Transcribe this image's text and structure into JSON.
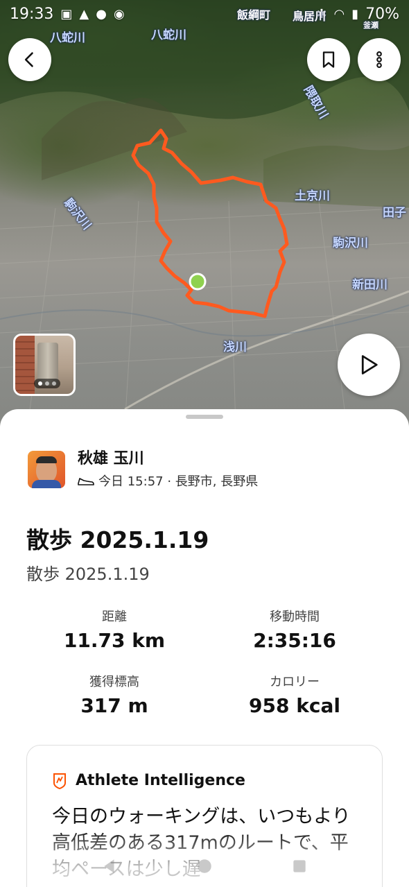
{
  "status_bar": {
    "time": "19:33",
    "battery": "70%"
  },
  "map": {
    "labels": [
      {
        "text": "八蛇川"
      },
      {
        "text": "八蛇川"
      },
      {
        "text": "隈取川"
      },
      {
        "text": "土京川"
      },
      {
        "text": "田子"
      },
      {
        "text": "駒沢川"
      },
      {
        "text": "駒沢川"
      },
      {
        "text": "新田川"
      },
      {
        "text": "浅川"
      },
      {
        "text": "飯綱町"
      },
      {
        "text": "鳥居川"
      },
      {
        "text": "釜瀬"
      }
    ],
    "route_color": "#ff5a1f",
    "start_marker_color": "#8fd14f"
  },
  "header": {
    "back_icon": "chevron-left-icon",
    "bookmark_icon": "bookmark-icon",
    "more_icon": "more-vertical-icon"
  },
  "play_icon": "play-icon",
  "athlete": {
    "name": "秋雄 玉川",
    "meta": "今日 15:57 · 長野市, 長野県",
    "activity_icon": "shoe-icon"
  },
  "activity": {
    "title": "散歩 2025.1.19",
    "description": "散歩 2025.1.19"
  },
  "stats": [
    {
      "label": "距離",
      "value": "11.73 km"
    },
    {
      "label": "移動時間",
      "value": "2:35:16"
    },
    {
      "label": "獲得標高",
      "value": "317 m"
    },
    {
      "label": "カロリー",
      "value": "958 kcal"
    }
  ],
  "athlete_intelligence": {
    "title": "Athlete Intelligence",
    "body": "今日のウォーキングは、いつもより高低差のある317mのルートで、平均ペースは少し遅",
    "icon": "athlete-intelligence-icon"
  },
  "brand_color": "#fc5200"
}
